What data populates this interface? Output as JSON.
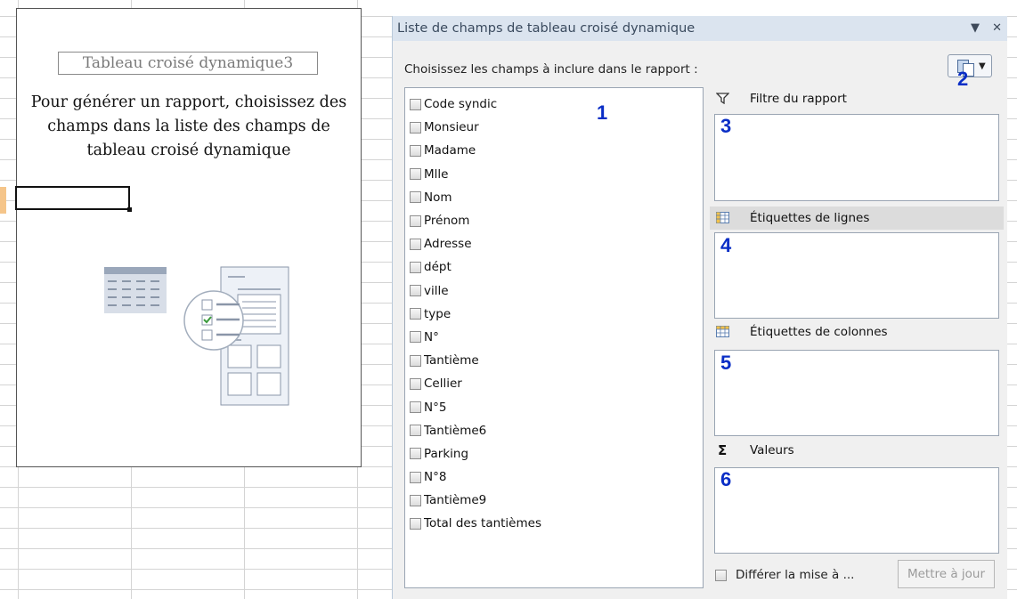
{
  "pivot_placeholder": {
    "name": "Tableau croisé dynamique3",
    "message": "Pour générer un rapport, choisissez des champs dans la liste des champs de tableau croisé dynamique"
  },
  "pane": {
    "title": "Liste de champs de tableau croisé dynamique",
    "dropdown_glyph": "▼",
    "close_glyph": "✕",
    "instruction": "Choisissez les champs à inclure dans le rapport :",
    "fields": [
      {
        "label": "Code syndic",
        "checked": false
      },
      {
        "label": "Monsieur",
        "checked": false
      },
      {
        "label": "Madame",
        "checked": false
      },
      {
        "label": "Mlle",
        "checked": false
      },
      {
        "label": "Nom",
        "checked": false
      },
      {
        "label": "Prénom",
        "checked": false
      },
      {
        "label": "Adresse",
        "checked": false
      },
      {
        "label": "dépt",
        "checked": false
      },
      {
        "label": "ville",
        "checked": false
      },
      {
        "label": "type",
        "checked": false
      },
      {
        "label": "N°",
        "checked": false
      },
      {
        "label": "Tantième",
        "checked": false
      },
      {
        "label": "Cellier",
        "checked": false
      },
      {
        "label": "N°5",
        "checked": false
      },
      {
        "label": "Tantième6",
        "checked": false
      },
      {
        "label": "Parking",
        "checked": false
      },
      {
        "label": "N°8",
        "checked": false
      },
      {
        "label": "Tantième9",
        "checked": false
      },
      {
        "label": "Total des tantièmes",
        "checked": false
      }
    ],
    "areas": {
      "filter": "Filtre du rapport",
      "rows": "Étiquettes de lignes",
      "columns": "Étiquettes de colonnes",
      "values": "Valeurs",
      "values_symbol": "Σ"
    },
    "defer_label": "Différer la mise à ...",
    "update_button": "Mettre à jour"
  },
  "annotations": {
    "n1": "1",
    "n2": "2",
    "n3": "3",
    "n4": "4",
    "n5": "5",
    "n6": "6"
  },
  "icons": {
    "filter": "funnel-icon",
    "rows": "row-labels-icon",
    "columns": "column-labels-icon",
    "values": "sigma-icon",
    "layout": "field-list-layout-icon"
  },
  "colors": {
    "annotation": "#0a2ec6",
    "pane_title_bg": "#dbe4ef"
  }
}
